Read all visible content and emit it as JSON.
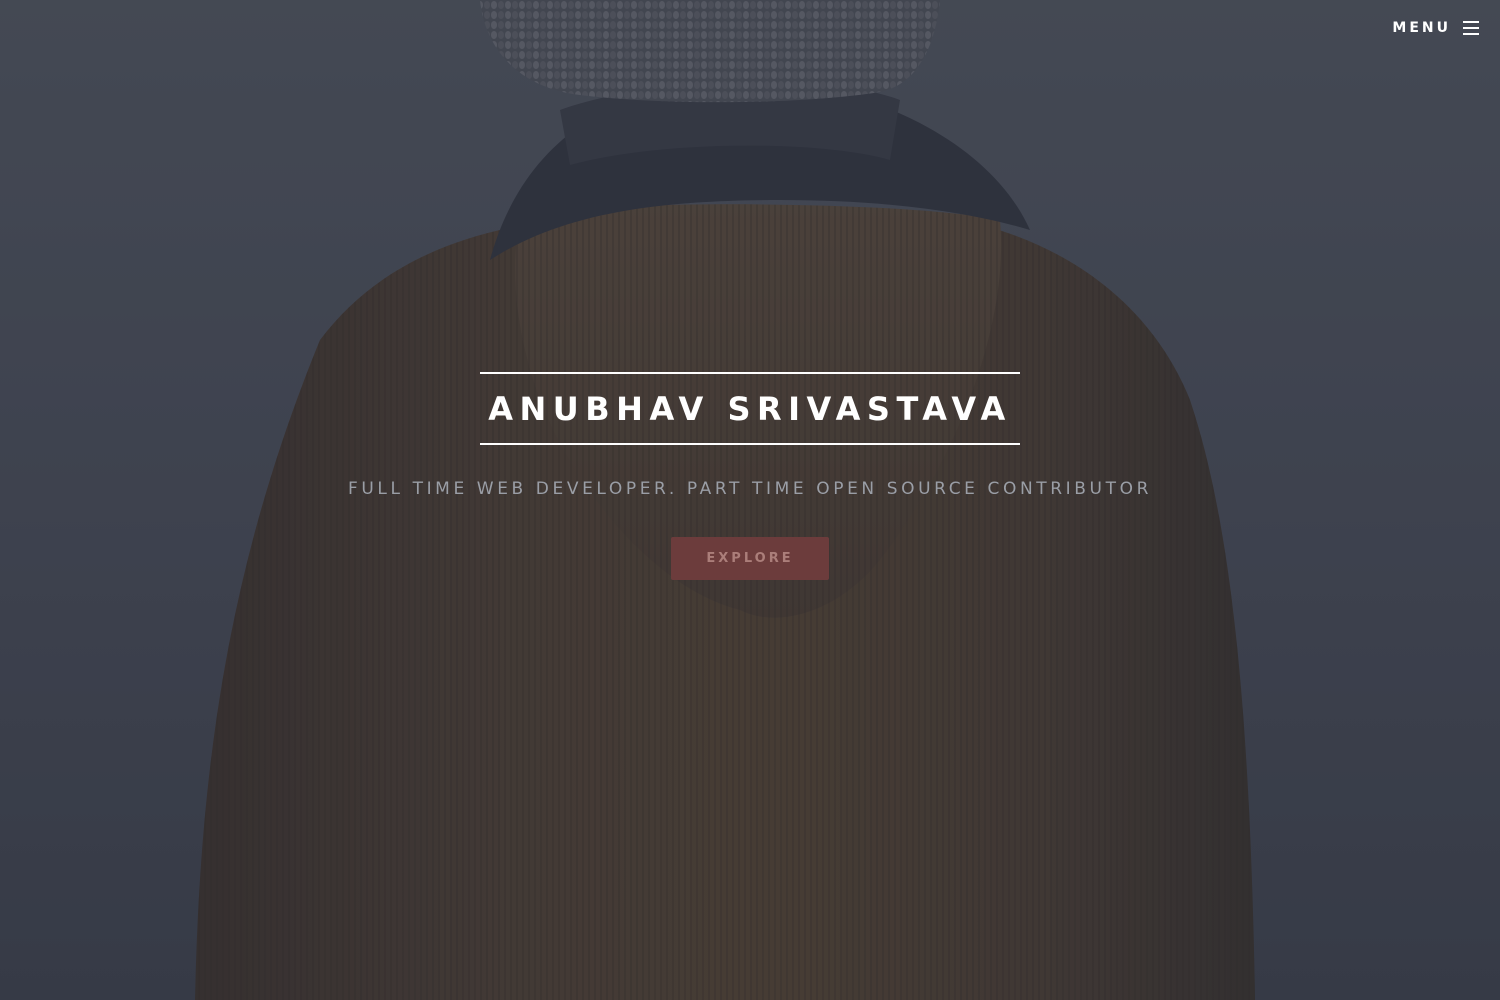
{
  "header": {
    "menu_label": "MENU"
  },
  "banner": {
    "title": "ANUBHAV SRIVASTAVA",
    "tagline": "FULL TIME WEB DEVELOPER. PART TIME OPEN SOURCE CONTRIBUTOR",
    "button_label": "EXPLORE"
  },
  "icons": {
    "menu": "hamburger-icon"
  },
  "colors": {
    "background": "#444a56",
    "title_text": "#ffffff",
    "tagline_text": "#9a9ea6",
    "button_background": "#6c3c3c",
    "button_text": "#ab7e7a",
    "jacket": "#4a3b2e"
  }
}
